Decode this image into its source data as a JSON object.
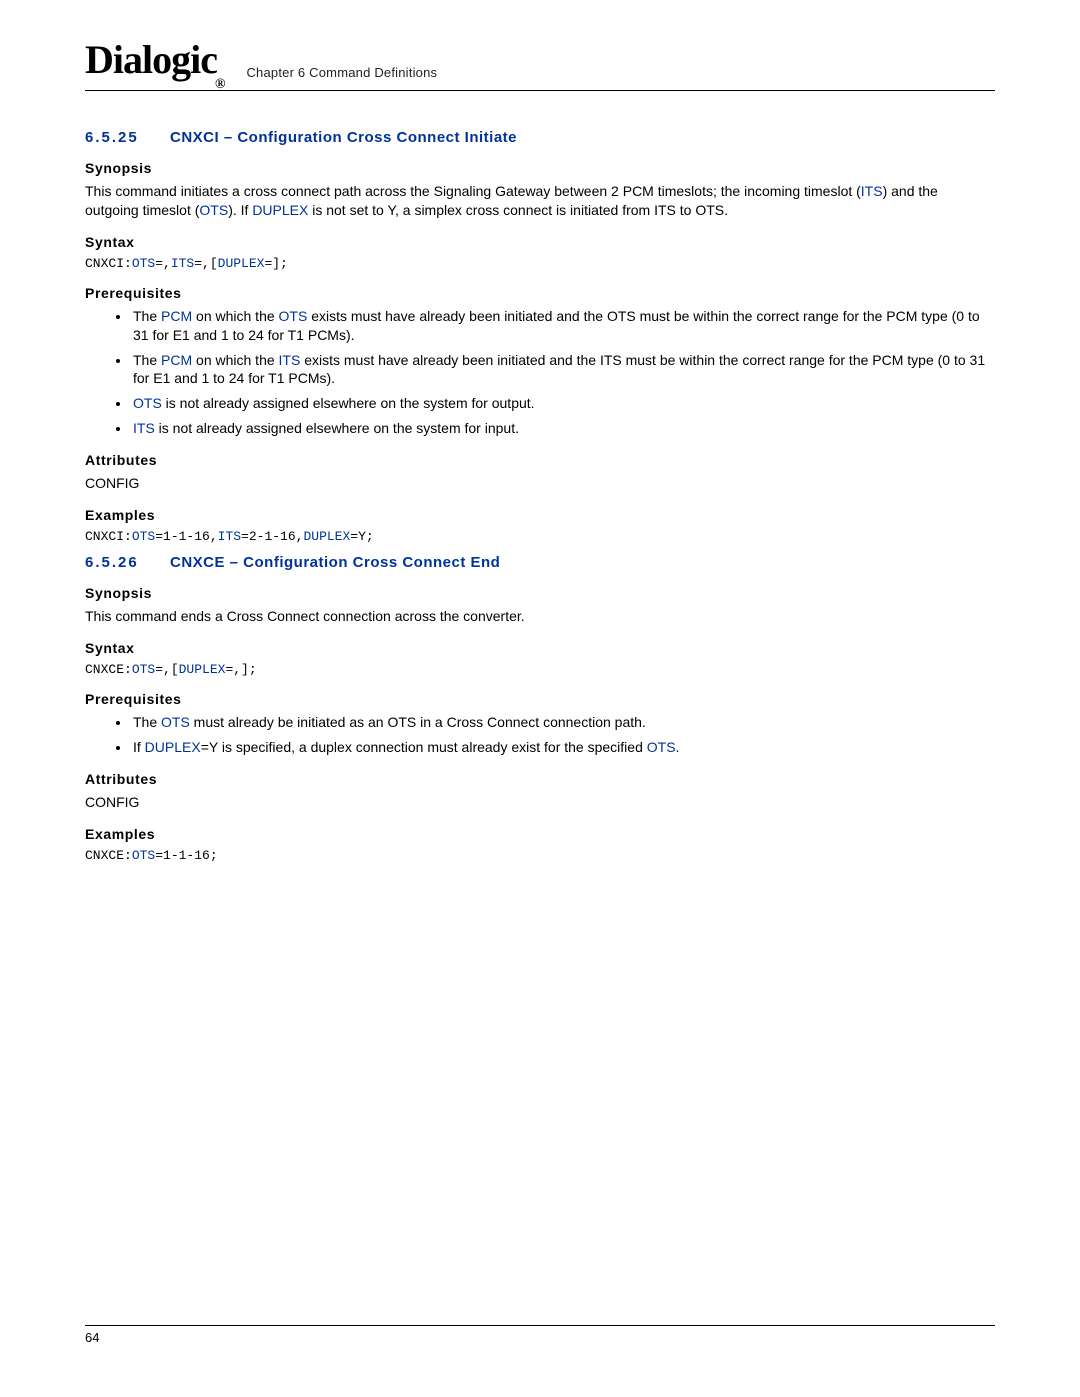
{
  "header": {
    "logo": "Dialogic",
    "reg": "®",
    "chapter": "Chapter 6 Command Definitions"
  },
  "sec1": {
    "num": "6.5.25",
    "title": "CNXCI – Configuration Cross Connect Initiate",
    "synopsis_label": "Synopsis",
    "synopsis_1a": "This command initiates a cross connect path across the Signaling Gateway between 2 PCM timeslots; the incoming timeslot (",
    "its": "ITS",
    "synopsis_1b": ") and the outgoing timeslot (",
    "ots": "OTS",
    "synopsis_1c": "). If ",
    "duplex": "DUPLEX",
    "synopsis_1d": " is not set to Y, a simplex cross connect is initiated from ITS to OTS.",
    "syntax_label": "Syntax",
    "syntax_cmd_a": "CNXCI:",
    "syntax_ots": "OTS",
    "syntax_eq1": "=,",
    "syntax_its": "ITS",
    "syntax_eq2": "=,[",
    "syntax_duplex": "DUPLEX",
    "syntax_eq3": "=];",
    "prereq_label": "Prerequisites",
    "prereq": [
      {
        "a": "The ",
        "l1": "PCM",
        "b": " on which the ",
        "l2": "OTS",
        "c": " exists must have already been initiated and the OTS must be within the correct range for the PCM type (0 to 31 for E1 and 1 to 24 for T1 PCMs)."
      },
      {
        "a": "The ",
        "l1": "PCM",
        "b": " on which the ",
        "l2": "ITS",
        "c": " exists must have already been initiated and the ITS must be within the correct range for the PCM type (0 to 31 for E1 and 1 to 24 for T1 PCMs)."
      },
      {
        "l1": "OTS",
        "c": " is not already assigned elsewhere on the system for output."
      },
      {
        "l1": "ITS",
        "c": " is not already assigned elsewhere on the system for input."
      }
    ],
    "attr_label": "Attributes",
    "attr_value": "CONFIG",
    "examples_label": "Examples",
    "ex_a": "CNXCI:",
    "ex_ots": "OTS",
    "ex_b": "=1-1-16,",
    "ex_its": "ITS",
    "ex_c": "=2-1-16,",
    "ex_dup": "DUPLEX",
    "ex_d": "=Y;"
  },
  "sec2": {
    "num": "6.5.26",
    "title": "CNXCE – Configuration Cross Connect End",
    "synopsis_label": "Synopsis",
    "synopsis": "This command ends a Cross Connect connection across the converter.",
    "syntax_label": "Syntax",
    "syntax_a": "CNXCE:",
    "syntax_ots": "OTS",
    "syntax_b": "=,[",
    "syntax_dup": "DUPLEX",
    "syntax_c": "=,];",
    "prereq_label": "Prerequisites",
    "prereq": [
      {
        "a": "The ",
        "l1": "OTS",
        "c": " must already be initiated as an OTS in a Cross Connect connection path."
      },
      {
        "a": "If ",
        "l1": "DUPLEX",
        "b": "=Y is specified, a duplex connection must already exist for the specified ",
        "l2": "OTS",
        "c": "."
      }
    ],
    "attr_label": "Attributes",
    "attr_value": "CONFIG",
    "examples_label": "Examples",
    "ex_a": "CNXCE:",
    "ex_ots": "OTS",
    "ex_b": "=1-1-16;"
  },
  "footer": {
    "page": "64"
  }
}
